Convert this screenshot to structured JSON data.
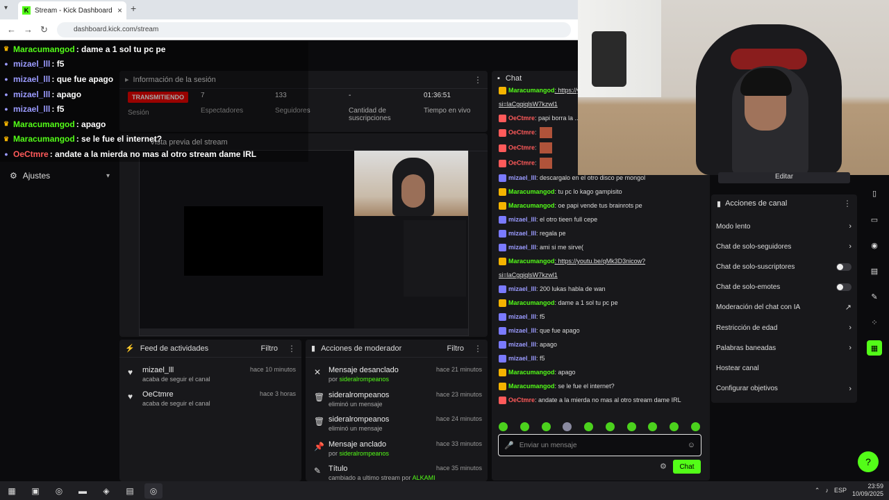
{
  "browser": {
    "tab_title": "Stream - Kick Dashboard",
    "url": "dashboard.kick.com/stream"
  },
  "overlay_chat": [
    {
      "user": "Maracumangod",
      "text": ": dame a 1 sol tu pc pe",
      "color": "#53fc18",
      "badge": "crown"
    },
    {
      "user": "mizael_lll",
      "text": ": f5",
      "color": "#9b9bff",
      "badge": "user"
    },
    {
      "user": "mizael_lll",
      "text": ": que fue apago",
      "color": "#9b9bff",
      "badge": "user"
    },
    {
      "user": "mizael_lll",
      "text": ": apago",
      "color": "#9b9bff",
      "badge": "user"
    },
    {
      "user": "mizael_lll",
      "text": ": f5",
      "color": "#9b9bff",
      "badge": "user"
    },
    {
      "user": "Maracumangod",
      "text": ": apago",
      "color": "#53fc18",
      "badge": "crown"
    },
    {
      "user": "Maracumangod",
      "text": ": se le fue el internet?",
      "color": "#53fc18",
      "badge": "crown"
    },
    {
      "user": "OeCtmre",
      "text": ": andate a la mierda no mas al otro stream dame IRL",
      "color": "#ff5a5a",
      "badge": "user"
    }
  ],
  "left_nav": {
    "settings_label": "Ajustes"
  },
  "session": {
    "title": "Información de la sesión",
    "live_label": "TRANSMITIENDO",
    "session_label": "Sesión",
    "viewers_value": "7",
    "viewers_label": "Espectadores",
    "followers_value": "133",
    "followers_label": "Seguidores",
    "subs_value": "-",
    "subs_label": "Cantidad de suscripciones",
    "time_value": "01:36:51",
    "time_label": "Tiempo en vivo"
  },
  "preview": {
    "title": "Vista previa del stream"
  },
  "activity": {
    "title": "Feed de actividades",
    "filter": "Filtro",
    "items": [
      {
        "name": "mizael_lll",
        "sub": "acaba de seguir el canal",
        "time": "hace 10 minutos"
      },
      {
        "name": "OeCtmre",
        "sub": "acaba de seguir el canal",
        "time": "hace 3 horas"
      }
    ]
  },
  "mod_actions": {
    "title": "Acciones de moderador",
    "filter": "Filtro",
    "items": [
      {
        "title": "Mensaje desanclado",
        "sub_prefix": "por ",
        "sub_user": "sideralrompeanos",
        "time": "hace 21 minutos",
        "icon": "unpin-icon"
      },
      {
        "title": "sideralrompeanos",
        "sub_prefix": "eliminó un mensaje",
        "sub_user": "",
        "time": "hace 23 minutos",
        "icon": "trash-icon"
      },
      {
        "title": "sideralrompeanos",
        "sub_prefix": "eliminó un mensaje",
        "sub_user": "",
        "time": "hace 24 minutos",
        "icon": "trash-icon"
      },
      {
        "title": "Mensaje anclado",
        "sub_prefix": "por ",
        "sub_user": "sideralrompeanos",
        "time": "hace 33 minutos",
        "icon": "pin-icon"
      },
      {
        "title": "Título",
        "sub_prefix": "cambiado a ultimo stream por ",
        "sub_user": "ALKAMI",
        "time": "hace 35 minutos",
        "icon": "title-icon"
      }
    ]
  },
  "chat": {
    "title": "Chat",
    "messages": [
      {
        "user": "Maracumangod",
        "color": "#53fc18",
        "text": ": https://youtu.be/...",
        "link": true
      },
      {
        "user": "",
        "color": "#ddd",
        "text": "si=laCgqiqlsW7kzwl1",
        "link": true
      },
      {
        "user": "OeCtmre",
        "color": "#ff5a5a",
        "text": ": papi borra la ..."
      },
      {
        "user": "OeCtmre",
        "color": "#ff5a5a",
        "text": ":",
        "emote": true
      },
      {
        "user": "OeCtmre",
        "color": "#ff5a5a",
        "text": ":",
        "emote": true
      },
      {
        "user": "OeCtmre",
        "color": "#ff5a5a",
        "text": ":",
        "emote": true
      },
      {
        "user": "mizael_lll",
        "color": "#9b9bff",
        "text": ": descargalo en el otro disco pe mongol"
      },
      {
        "user": "Maracumangod",
        "color": "#53fc18",
        "text": ": tu pc lo kago gampisito"
      },
      {
        "user": "Maracumangod",
        "color": "#53fc18",
        "text": ": oe papi vende tus brainrots pe"
      },
      {
        "user": "mizael_lll",
        "color": "#9b9bff",
        "text": ": el otro tieen full cepe"
      },
      {
        "user": "mizael_lll",
        "color": "#9b9bff",
        "text": ": regala pe"
      },
      {
        "user": "mizael_lll",
        "color": "#9b9bff",
        "text": ": ami si me sirve("
      },
      {
        "user": "Maracumangod",
        "color": "#53fc18",
        "text": ": https://youtu.be/qMk3D3nicow?",
        "link": true
      },
      {
        "user": "",
        "color": "#ddd",
        "text": "si=laCgqiqlsW7kzwl1",
        "link": true
      },
      {
        "user": "mizael_lll",
        "color": "#9b9bff",
        "text": ": 200 lukas habla de wan"
      },
      {
        "user": "Maracumangod",
        "color": "#53fc18",
        "text": ": dame a 1 sol tu pc pe"
      },
      {
        "user": "mizael_lll",
        "color": "#9b9bff",
        "text": ": f5"
      },
      {
        "user": "mizael_lll",
        "color": "#9b9bff",
        "text": ": que fue apago"
      },
      {
        "user": "mizael_lll",
        "color": "#9b9bff",
        "text": ": apago"
      },
      {
        "user": "mizael_lll",
        "color": "#9b9bff",
        "text": ": f5"
      },
      {
        "user": "Maracumangod",
        "color": "#53fc18",
        "text": ": apago"
      },
      {
        "user": "Maracumangod",
        "color": "#53fc18",
        "text": ": se le fue el internet?"
      },
      {
        "user": "OeCtmre",
        "color": "#ff5a5a",
        "text": ": andate a la mierda no mas al otro stream dame IRL"
      }
    ],
    "input_placeholder": "Enviar un mensaje",
    "send_label": "Chat"
  },
  "channel_actions": {
    "edit_label": "Editar",
    "title": "Acciones de canal",
    "items": [
      {
        "label": "Modo lento",
        "control": "chevron"
      },
      {
        "label": "Chat de solo-seguidores",
        "control": "chevron"
      },
      {
        "label": "Chat de solo-suscriptores",
        "control": "toggle"
      },
      {
        "label": "Chat de solo-emotes",
        "control": "toggle"
      },
      {
        "label": "Moderación del chat con IA",
        "control": "external"
      },
      {
        "label": "Restricción de edad",
        "control": "chevron"
      },
      {
        "label": "Palabras baneadas",
        "control": "chevron"
      },
      {
        "label": "Hostear canal",
        "control": "none"
      },
      {
        "label": "Configurar objetivos",
        "control": "chevron"
      }
    ]
  },
  "taskbar": {
    "lang": "ESP",
    "time": "23:59",
    "date": "10/09/2025"
  },
  "colors": {
    "brand": "#53fc18",
    "live": "#eb0400",
    "panel": "#18181b"
  }
}
